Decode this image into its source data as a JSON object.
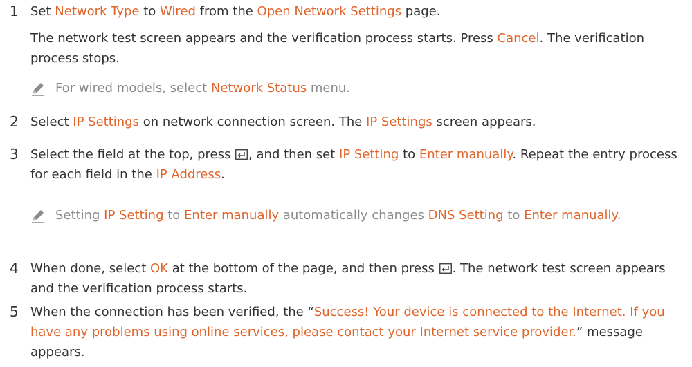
{
  "colors": {
    "highlight": "#e0652a",
    "text": "#333333",
    "note": "#8b8b8b"
  },
  "steps": [
    {
      "number": "1",
      "parts": [
        "Set ",
        "Network Type",
        " to ",
        "Wired",
        " from the ",
        "Open Network Settings",
        " page."
      ],
      "para2": [
        "The network test screen appears and the verification process starts. Press ",
        "Cancel",
        ". The verification process stops."
      ],
      "note": [
        "For wired models, select ",
        "Network Status",
        " menu."
      ]
    },
    {
      "number": "2",
      "parts": [
        "Select ",
        "IP Settings",
        " on network connection screen. The ",
        "IP Settings",
        " screen appears."
      ]
    },
    {
      "number": "3",
      "parts": [
        "Select the field at the top, press ",
        ", and then set ",
        "IP Setting",
        " to ",
        "Enter manually",
        ". Repeat the entry process for each field in the ",
        "IP Address",
        "."
      ],
      "note": [
        "Setting ",
        "IP Setting",
        " to ",
        "Enter manually",
        " automatically changes ",
        "DNS Setting",
        " to ",
        "Enter manually",
        "."
      ]
    },
    {
      "number": "4",
      "parts": [
        "When done, select ",
        "OK",
        " at the bottom of the page, and then press ",
        ". The network test screen appears and the verification process starts."
      ]
    },
    {
      "number": "5",
      "parts": [
        "When the connection has been verified, the “",
        "Success! Your device is connected to the Internet. If you have any problems using online services, please contact your Internet service provider.",
        "” message appears."
      ]
    }
  ],
  "icons": {
    "note": "pencil-icon",
    "enter": "enter-key-icon"
  }
}
